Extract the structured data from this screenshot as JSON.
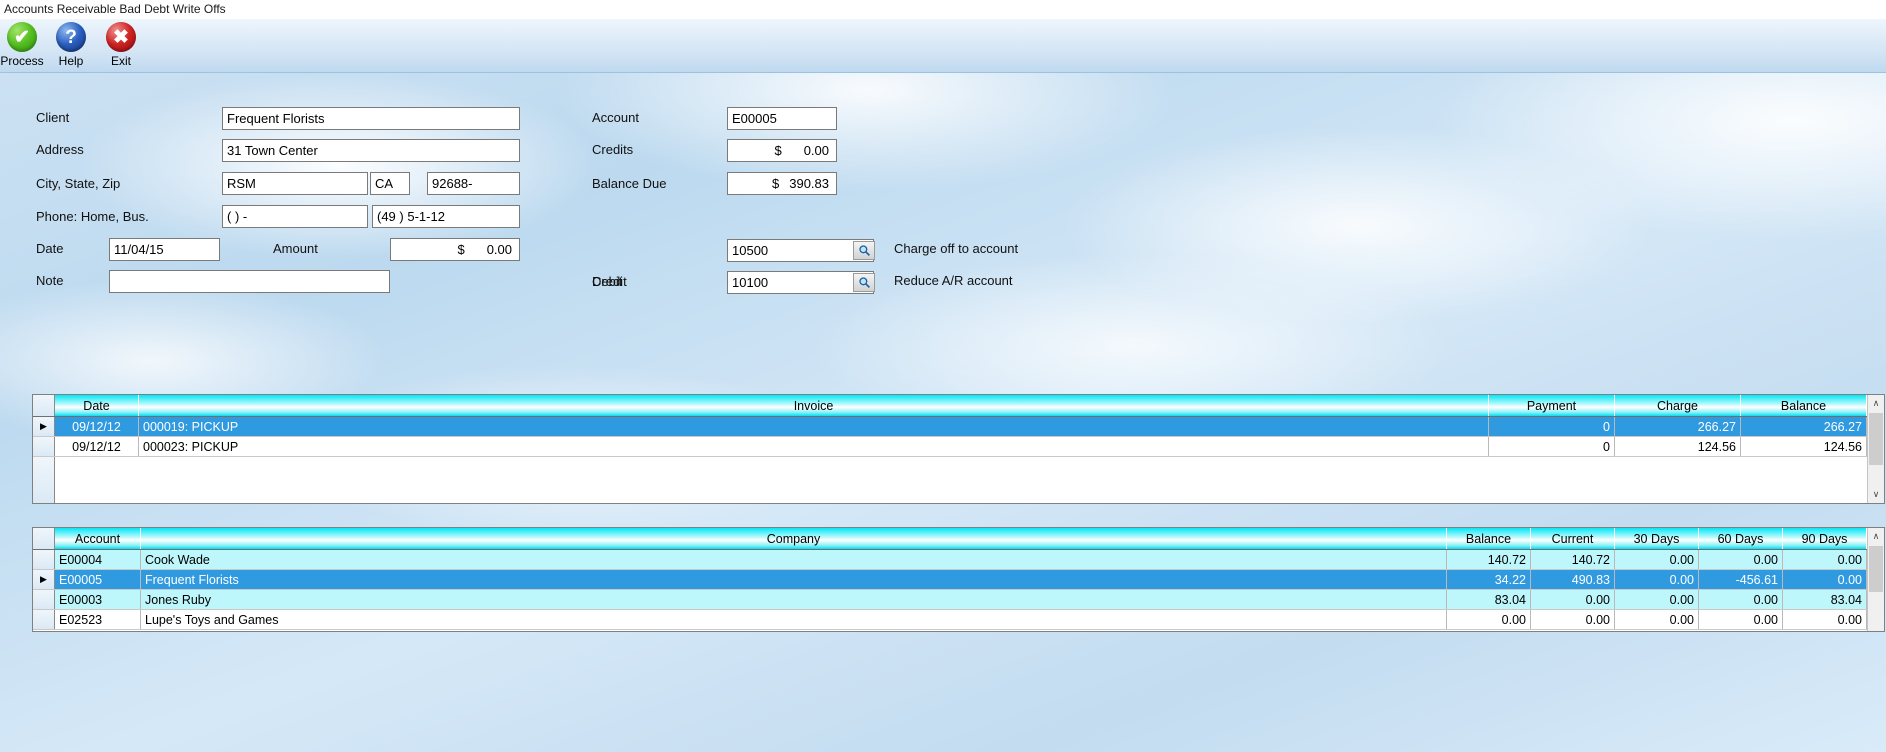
{
  "window": {
    "title": "Accounts Receivable Bad Debt Write Offs"
  },
  "toolbar": {
    "buttons": [
      {
        "label": "Process",
        "icon": "check-circle-icon",
        "glyph": "✔"
      },
      {
        "label": "Help",
        "icon": "question-circle-icon",
        "glyph": "?"
      },
      {
        "label": "Exit",
        "icon": "close-circle-icon",
        "glyph": "✖"
      }
    ]
  },
  "form": {
    "client": {
      "label": "Client",
      "value": "Frequent Florists"
    },
    "address": {
      "label": "Address",
      "value": "31 Town Center"
    },
    "city_state_zip": {
      "label": "City, State, Zip",
      "city": "RSM",
      "state": "CA",
      "zip": "92688-"
    },
    "phone": {
      "label": "Phone: Home, Bus.",
      "home": "(   )    -",
      "business": "(49 ) 5-1-12"
    },
    "date": {
      "label": "Date",
      "value": "11/04/15"
    },
    "amount": {
      "label": "Amount",
      "symbol": "$",
      "value": "0.00"
    },
    "note": {
      "label": "Note",
      "value": ""
    },
    "account": {
      "label": "Account",
      "value": "E00005"
    },
    "credits": {
      "label": "Credits",
      "symbol": "$",
      "value": "0.00"
    },
    "balance_due": {
      "label": "Balance Due",
      "symbol": "$",
      "value": "390.83"
    },
    "debit": {
      "label": "Debit",
      "value": "10500",
      "hint": "Charge off to account",
      "lookup_icon": "magnifier-icon"
    },
    "credit": {
      "label": "Credit",
      "value": "10100",
      "hint": "Reduce A/R account",
      "lookup_icon": "magnifier-icon"
    }
  },
  "invoice_grid": {
    "columns": [
      "Date",
      "Invoice",
      "Payment",
      "Charge",
      "Balance"
    ],
    "rows": [
      {
        "marker": "▶",
        "selected": true,
        "date": "09/12/12",
        "invoice": "000019: PICKUP",
        "payment": "0",
        "charge": "266.27",
        "balance": "266.27"
      },
      {
        "marker": "",
        "selected": false,
        "date": "09/12/12",
        "invoice": "000023: PICKUP",
        "payment": "0",
        "charge": "124.56",
        "balance": "124.56"
      }
    ]
  },
  "aging_grid": {
    "columns": [
      "Account",
      "Company",
      "Balance",
      "Current",
      "30 Days",
      "60 Days",
      "90 Days"
    ],
    "rows": [
      {
        "marker": "",
        "selected": false,
        "account": "E00004",
        "company": "Cook          Wade",
        "balance": "140.72",
        "current": "140.72",
        "d30": "0.00",
        "d60": "0.00",
        "d90": "0.00"
      },
      {
        "marker": "▶",
        "selected": true,
        "account": "E00005",
        "company": "Frequent Florists",
        "balance": "34.22",
        "current": "490.83",
        "d30": "0.00",
        "d60": "-456.61",
        "d90": "0.00"
      },
      {
        "marker": "",
        "selected": false,
        "account": "E00003",
        "company": "Jones         Ruby",
        "balance": "83.04",
        "current": "0.00",
        "d30": "0.00",
        "d60": "0.00",
        "d90": "83.04"
      },
      {
        "marker": "",
        "selected": false,
        "account": "E02523",
        "company": "Lupe's Toys and Games",
        "balance": "0.00",
        "current": "0.00",
        "d30": "0.00",
        "d60": "0.00",
        "d90": "0.00"
      }
    ]
  },
  "scrollbars": {
    "up_glyph": "∧",
    "down_glyph": "∨"
  },
  "colors": {
    "selection": "#2f9ae0",
    "header_cyan": "#05e6f5",
    "alt_row": "#bdf6fb"
  }
}
